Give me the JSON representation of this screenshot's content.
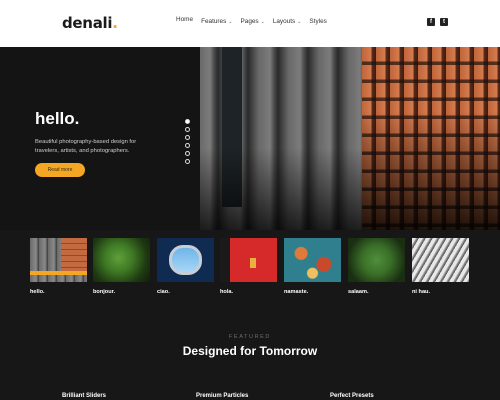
{
  "logo": {
    "text": "denali",
    "dot": "."
  },
  "nav": [
    {
      "label": "Home",
      "chevron": false,
      "active": true
    },
    {
      "label": "Features",
      "chevron": true
    },
    {
      "label": "Pages",
      "chevron": true
    },
    {
      "label": "Layouts",
      "chevron": true
    },
    {
      "label": "Styles",
      "chevron": false
    }
  ],
  "social": [
    {
      "icon": "facebook-icon",
      "glyph": "f"
    },
    {
      "icon": "twitter-icon",
      "glyph": "t"
    }
  ],
  "hero": {
    "title": "hello.",
    "description": "Beautiful photography-based design for travelers, artists, and photographers.",
    "button": "Read more",
    "dots_total": 6,
    "dot_active": 1
  },
  "thumbnails": [
    {
      "caption": "hello.",
      "active": true
    },
    {
      "caption": "bonjour."
    },
    {
      "caption": "ciao."
    },
    {
      "caption": "hola."
    },
    {
      "caption": "namaste."
    },
    {
      "caption": "salaam."
    },
    {
      "caption": "ni hau."
    }
  ],
  "featured": {
    "kicker": "FEATURED",
    "title": "Designed for Tomorrow"
  },
  "features": [
    {
      "label": "Brilliant Sliders"
    },
    {
      "label": "Premium Particles"
    },
    {
      "label": "Perfect Presets"
    }
  ],
  "colors": {
    "accent": "#f5a623",
    "background": "#171717",
    "header": "#ffffff"
  }
}
